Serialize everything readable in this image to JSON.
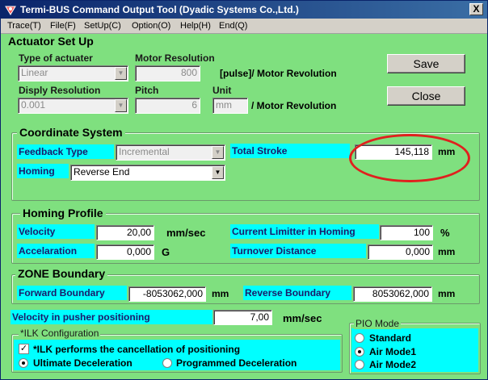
{
  "window": {
    "title": "Termi-BUS Command Output Tool (Dyadic Systems Co.,Ltd.)",
    "close": "X"
  },
  "menu": [
    "Trace(T)",
    "File(F)",
    "SetUp(C)",
    "Option(O)",
    "Help(H)",
    "End(Q)"
  ],
  "actuator": {
    "title": "Actuator Set Up",
    "type_label": "Type of actuater",
    "type_value": "Linear",
    "motor_res_label": "Motor Resolution",
    "motor_res_value": "800",
    "motor_res_unit": "[pulse]/ Motor Revolution",
    "disp_res_label": "Disply Resolution",
    "disp_res_value": "0.001",
    "pitch_label": "Pitch",
    "pitch_value": "6",
    "unit_label": "Unit",
    "unit_value": "mm",
    "unit_suffix": "/ Motor Revolution"
  },
  "buttons": {
    "save": "Save",
    "close": "Close"
  },
  "coordinate": {
    "title": "Coordinate System",
    "feedback_label": "Feedback Type",
    "feedback_value": "Incremental",
    "stroke_label": "Total Stroke",
    "stroke_value": "145,118",
    "stroke_unit": "mm",
    "homing_label": "Homing",
    "homing_value": "Reverse End"
  },
  "homing_profile": {
    "title": "Homing Profile",
    "velocity_label": "Velocity",
    "velocity_value": "20,00",
    "velocity_unit": "mm/sec",
    "current_label": "Current Limitter in Homing",
    "current_value": "100",
    "current_unit": "%",
    "accel_label": "Accelaration",
    "accel_value": "0,000",
    "accel_unit": "G",
    "turnover_label": "Turnover Distance",
    "turnover_value": "0,000",
    "turnover_unit": "mm"
  },
  "zone": {
    "title": "ZONE Boundary",
    "forward_label": "Forward Boundary",
    "forward_value": "-8053062,000",
    "forward_unit": "mm",
    "reverse_label": "Reverse Boundary",
    "reverse_value": "8053062,000",
    "reverse_unit": "mm"
  },
  "pusher": {
    "label": "Velocity in pusher positioning",
    "value": "7,00",
    "unit": "mm/sec"
  },
  "ilk": {
    "title": "*ILK Configuration",
    "checkbox_label": "*ILK performs the cancellation of positioning",
    "checkbox_mark": "✓",
    "ultimate_label": "Ultimate Deceleration",
    "programmed_label": "Programmed Deceleration"
  },
  "pio": {
    "title": "PIO Mode",
    "options": [
      "Standard",
      "Air Mode1",
      "Air Mode2"
    ],
    "selected": "Air Mode1"
  },
  "colors": {
    "background": "#7fe07f",
    "label_highlight": "#00ffff",
    "annotation": "#e0201e",
    "titlebar": "#0a246a"
  }
}
